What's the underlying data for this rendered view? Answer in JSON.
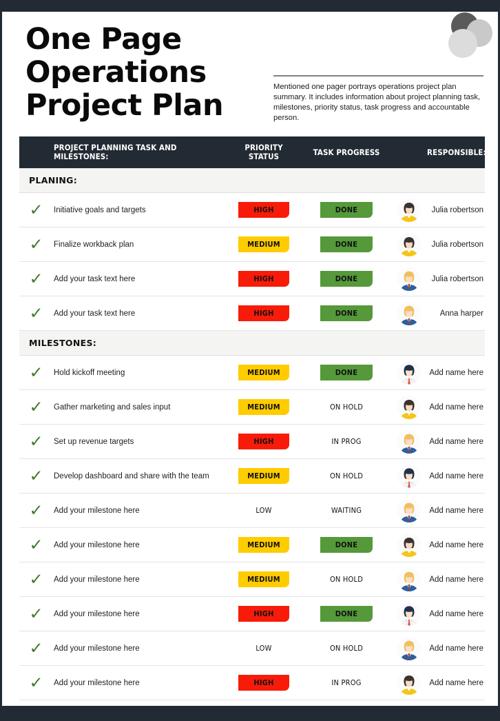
{
  "document": {
    "title_line1": "One Page Operations",
    "title_line2": "Project Plan",
    "description": "Mentioned one pager portrays operations project plan summary. It includes information about project planning task, milestones, priority status, task progress and accountable person."
  },
  "colors": {
    "dark_bar": "#222a33",
    "priority_high": "#f81b09",
    "priority_medium": "#ffcc00",
    "progress_done": "#55993a",
    "check_green": "#3f7a2e",
    "section_bg": "#f4f4f2"
  },
  "table": {
    "columns": [
      {
        "key": "check",
        "label": ""
      },
      {
        "key": "task",
        "label": "PROJECT PLANNING TASK AND MILESTONES:"
      },
      {
        "key": "priority",
        "label": "PRIORITY STATUS"
      },
      {
        "key": "progress",
        "label": "TASK PROGRESS"
      },
      {
        "key": "avatar",
        "label": ""
      },
      {
        "key": "resp",
        "label": "RESPONSIBLE:"
      }
    ],
    "header": {
      "task": "PROJECT PLANNING TASK AND MILESTONES:",
      "priority_l1": "PRIORITY",
      "priority_l2": "STATUS",
      "progress": "TASK PROGRESS",
      "responsible": "RESPONSIBLE:"
    },
    "sections": [
      {
        "label": "PLANING:",
        "rows": [
          {
            "check": "✓",
            "task": "Initiative goals and targets",
            "priority": "HIGH",
            "priority_style": "high",
            "progress": "DONE",
            "progress_style": "done",
            "avatar": "avatar-woman-dark-hair-yellow",
            "responsible": "Julia robertson"
          },
          {
            "check": "✓",
            "task": "Finalize workback plan",
            "priority": "MEDIUM",
            "priority_style": "medium",
            "progress": "DONE",
            "progress_style": "done",
            "avatar": "avatar-woman-dark-hair-yellow",
            "responsible": "Julia robertson"
          },
          {
            "check": "✓",
            "task": "Add your task text here",
            "priority": "HIGH",
            "priority_style": "high",
            "progress": "DONE",
            "progress_style": "done",
            "avatar": "avatar-woman-blonde-blue",
            "responsible": "Julia robertson"
          },
          {
            "check": "✓",
            "task": "Add your task text here",
            "priority": "HIGH",
            "priority_style": "high",
            "progress": "DONE",
            "progress_style": "done",
            "avatar": "avatar-woman-blonde-blue",
            "responsible": "Anna harper"
          }
        ]
      },
      {
        "label": "MILESTONES:",
        "rows": [
          {
            "check": "✓",
            "task": "Hold kickoff meeting",
            "priority": "MEDIUM",
            "priority_style": "medium",
            "progress": "DONE",
            "progress_style": "done",
            "avatar": "avatar-man-red-tie",
            "responsible": "Add name here"
          },
          {
            "check": "✓",
            "task": "Gather marketing and sales input",
            "priority": "MEDIUM",
            "priority_style": "medium",
            "progress": "ON HOLD",
            "progress_style": "plain",
            "avatar": "avatar-woman-dark-hair-yellow",
            "responsible": "Add name here"
          },
          {
            "check": "✓",
            "task": "Set up revenue targets",
            "priority": "HIGH",
            "priority_style": "high",
            "progress": "IN PROG",
            "progress_style": "plain",
            "avatar": "avatar-woman-blonde-blue",
            "responsible": "Add name here"
          },
          {
            "check": "✓",
            "task": "Develop dashboard and share with the team",
            "priority": "MEDIUM",
            "priority_style": "medium",
            "progress": "ON HOLD",
            "progress_style": "plain",
            "avatar": "avatar-man-red-tie",
            "responsible": "Add name here"
          },
          {
            "check": "✓",
            "task": "Add your milestone here",
            "priority": "LOW",
            "priority_style": "plain",
            "progress": "WAITING",
            "progress_style": "plain",
            "avatar": "avatar-woman-blonde-blue",
            "responsible": "Add name here"
          },
          {
            "check": "✓",
            "task": "Add your milestone here",
            "priority": "MEDIUM",
            "priority_style": "medium",
            "progress": "DONE",
            "progress_style": "done",
            "avatar": "avatar-woman-dark-hair-yellow",
            "responsible": "Add name here"
          },
          {
            "check": "✓",
            "task": "Add your milestone here",
            "priority": "MEDIUM",
            "priority_style": "medium",
            "progress": "ON HOLD",
            "progress_style": "plain",
            "avatar": "avatar-woman-blonde-blue",
            "responsible": "Add name here"
          },
          {
            "check": "✓",
            "task": "Add your milestone here",
            "priority": "HIGH",
            "priority_style": "high",
            "progress": "DONE",
            "progress_style": "done",
            "avatar": "avatar-man-red-tie",
            "responsible": "Add name here"
          },
          {
            "check": "✓",
            "task": "Add your milestone here",
            "priority": "LOW",
            "priority_style": "plain",
            "progress": "ON HOLD",
            "progress_style": "plain",
            "avatar": "avatar-woman-blonde-blue",
            "responsible": "Add name here"
          },
          {
            "check": "✓",
            "task": "Add your milestone here",
            "priority": "HIGH",
            "priority_style": "high",
            "progress": "IN PROG",
            "progress_style": "plain",
            "avatar": "avatar-woman-dark-hair-yellow",
            "responsible": "Add name here"
          }
        ]
      }
    ]
  }
}
